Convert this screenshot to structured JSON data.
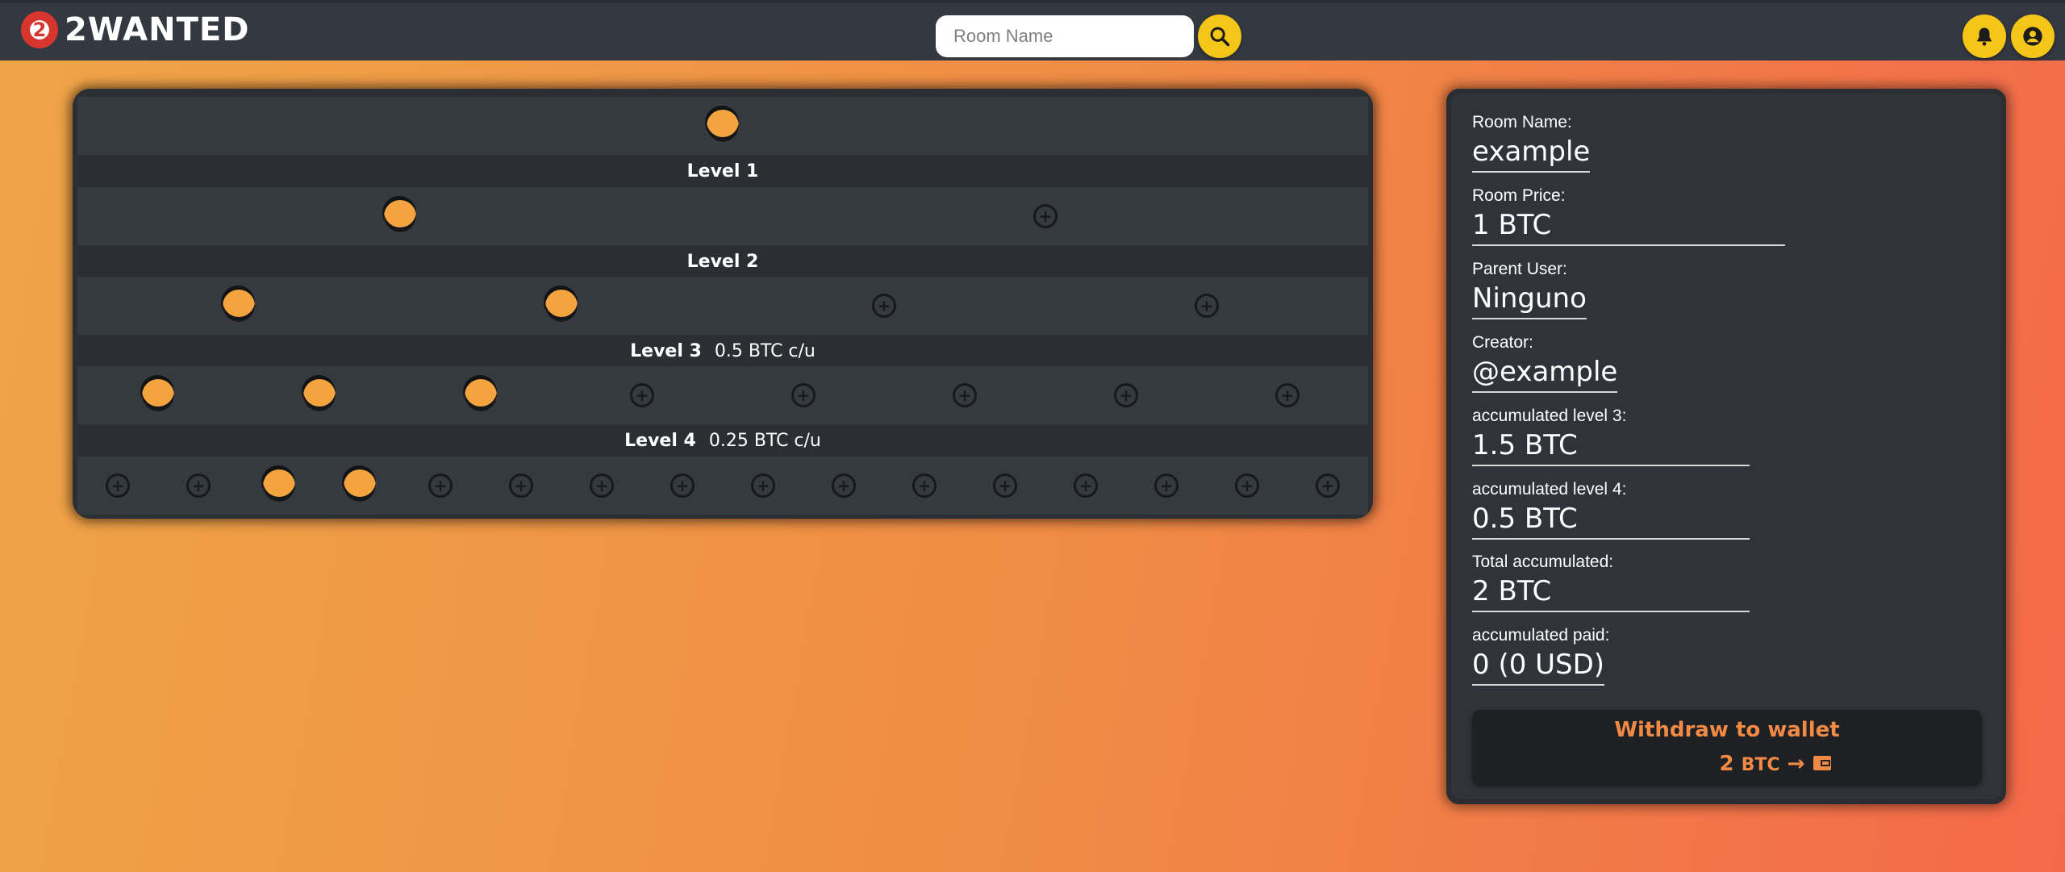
{
  "header": {
    "brand_logo_text": "2",
    "brand_name": "2WANTED",
    "search_placeholder": "Room Name"
  },
  "tree": {
    "levels": [
      {
        "label": "Level 1",
        "price": "",
        "slots": [
          "filled"
        ]
      },
      {
        "label": "Level 2",
        "price": "",
        "slots": [
          "filled",
          "empty"
        ]
      },
      {
        "label": "Level 3",
        "price": "0.5 BTC  c/u",
        "slots": [
          "filled",
          "filled",
          "empty",
          "empty"
        ]
      },
      {
        "label": "Level 4",
        "price": "0.25 BTC  c/u",
        "slots": [
          "filled",
          "filled",
          "filled",
          "empty",
          "empty",
          "empty",
          "empty",
          "empty"
        ]
      }
    ],
    "bottom_slots": [
      "empty",
      "empty",
      "filled",
      "filled",
      "empty",
      "empty",
      "empty",
      "empty",
      "empty",
      "empty",
      "empty",
      "empty",
      "empty",
      "empty",
      "empty",
      "empty"
    ]
  },
  "info": {
    "room_name_label": "Room Name:",
    "room_name_value": "example",
    "room_price_label": "Room Price:",
    "room_price_value": "1 BTC",
    "parent_user_label": "Parent User:",
    "parent_user_value": "Ninguno",
    "creator_label": "Creator:",
    "creator_value": "@example",
    "acc_level3_label": "accumulated level 3:",
    "acc_level3_value": "1.5 BTC",
    "acc_level4_label": "accumulated level 4:",
    "acc_level4_value": "0.5 BTC",
    "total_label": "Total accumulated:",
    "total_value": "2 BTC",
    "paid_label": "accumulated paid:",
    "paid_value": "0 (0 USD)"
  },
  "withdraw": {
    "title": "Withdraw to wallet",
    "amount": "2",
    "unit": "BTC",
    "arrow": "→"
  },
  "colors": {
    "accent": "#f5c518",
    "node_filled": "#f3a43e",
    "withdraw_text": "#f08a45"
  }
}
